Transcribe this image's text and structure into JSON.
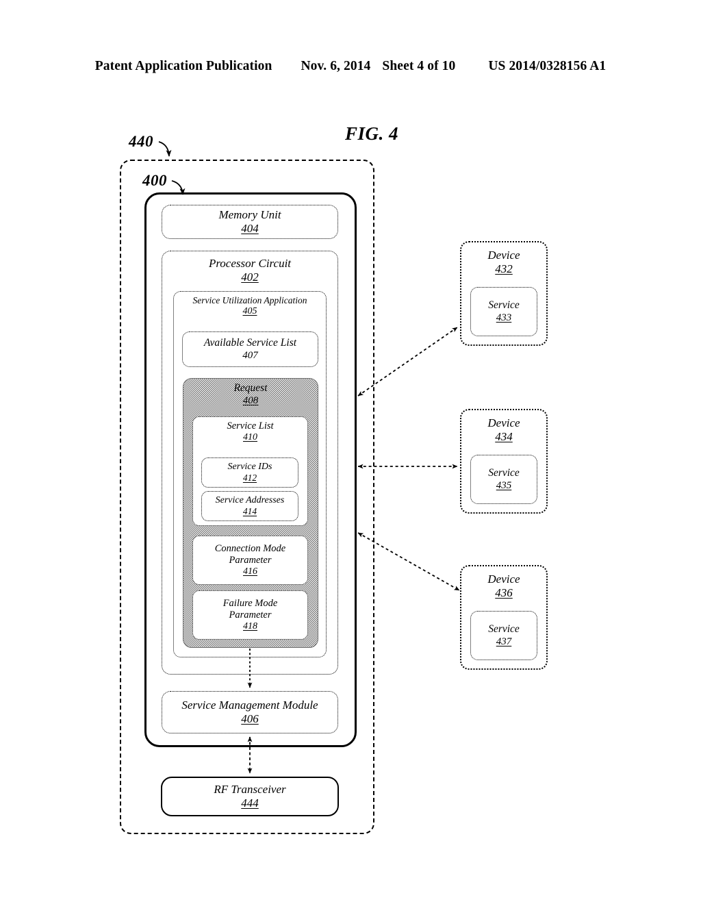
{
  "header": {
    "title": "Patent Application Publication",
    "date": "Nov. 6, 2014",
    "sheet": "Sheet 4 of 10",
    "publication_number": "US 2014/0328156 A1"
  },
  "figure": {
    "title": "FIG. 4",
    "callouts": [
      {
        "id": "440",
        "label": "440"
      },
      {
        "id": "400",
        "label": "400"
      }
    ]
  },
  "diagram": {
    "system_boundary": {
      "ref": "440"
    },
    "device": {
      "ref": "400"
    },
    "memory_unit": {
      "label": "Memory Unit",
      "ref": "404"
    },
    "processor_circuit": {
      "label": "Processor Circuit",
      "ref": "402"
    },
    "service_utilization_application": {
      "label": "Service Utilization Application",
      "ref": "405"
    },
    "available_service_list": {
      "label": "Available Service List",
      "ref": "407"
    },
    "request": {
      "label": "Request",
      "ref": "408"
    },
    "service_list": {
      "label": "Service List",
      "ref": "410"
    },
    "service_ids": {
      "label": "Service IDs",
      "ref": "412"
    },
    "service_addresses": {
      "label": "Service Addresses",
      "ref": "414"
    },
    "connection_mode_parameter": {
      "label_line1": "Connection Mode",
      "label_line2": "Parameter",
      "ref": "416"
    },
    "failure_mode_parameter": {
      "label_line1": "Failure Mode",
      "label_line2": "Parameter",
      "ref": "418"
    },
    "service_management_module": {
      "label": "Service Management Module",
      "ref": "406"
    },
    "rf_transceiver": {
      "label": "RF Transceiver",
      "ref": "444"
    },
    "devices": [
      {
        "label": "Device",
        "ref": "432",
        "service": {
          "label": "Service",
          "ref": "433"
        }
      },
      {
        "label": "Device",
        "ref": "434",
        "service": {
          "label": "Service",
          "ref": "435"
        }
      },
      {
        "label": "Device",
        "ref": "436",
        "service": {
          "label": "Service",
          "ref": "437"
        }
      }
    ]
  },
  "colors": {
    "ink": "#000000",
    "page": "#ffffff",
    "request_shading": "#b9b9b9"
  }
}
